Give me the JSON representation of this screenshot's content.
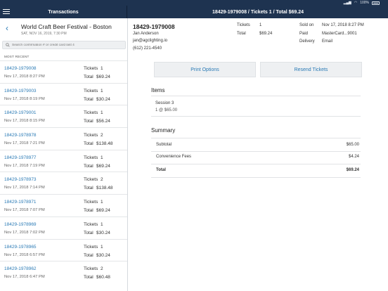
{
  "status": {
    "battery": "100%"
  },
  "nav": {
    "left_title": "Transactions",
    "right_title": "18429-1979008 / Tickets 1 / Total $69.24"
  },
  "event": {
    "name": "World Craft Beer Festival - Boston",
    "date": "SAT, NOV 16, 2019, 7:30 PM"
  },
  "search": {
    "placeholder": "Search confirmation # or credit card last 4"
  },
  "list_label": "MOST RECENT",
  "labels": {
    "tickets": "Tickets",
    "total": "Total"
  },
  "transactions": [
    {
      "id": "18429-1979008",
      "date": "Nov 17, 2018 8:27 PM",
      "tickets": "1",
      "total": "$69.24"
    },
    {
      "id": "18429-1979003",
      "date": "Nov 17, 2018 8:19 PM",
      "tickets": "1",
      "total": "$30.24"
    },
    {
      "id": "18429-1979001",
      "date": "Nov 17, 2018 8:15 PM",
      "tickets": "1",
      "total": "$56.24"
    },
    {
      "id": "18429-1978978",
      "date": "Nov 17, 2018 7:21 PM",
      "tickets": "2",
      "total": "$138.48"
    },
    {
      "id": "18429-1978977",
      "date": "Nov 17, 2018 7:19 PM",
      "tickets": "1",
      "total": "$69.24"
    },
    {
      "id": "18429-1978973",
      "date": "Nov 17, 2018 7:14 PM",
      "tickets": "2",
      "total": "$138.48"
    },
    {
      "id": "18429-1978971",
      "date": "Nov 17, 2018 7:07 PM",
      "tickets": "1",
      "total": "$69.24"
    },
    {
      "id": "18429-1978969",
      "date": "Nov 17, 2018 7:02 PM",
      "tickets": "1",
      "total": "$30.24"
    },
    {
      "id": "18429-1978965",
      "date": "Nov 17, 2018 6:57 PM",
      "tickets": "1",
      "total": "$30.24"
    },
    {
      "id": "18429-1978962",
      "date": "Nov 17, 2018 6:47 PM",
      "tickets": "2",
      "total": "$60.48"
    }
  ],
  "detail": {
    "order_id": "18429-1979008",
    "name": "Jan Anderson",
    "email": "jan@agclighting.io",
    "phone": "(612) 221-4540",
    "tickets_label": "Tickets",
    "tickets_value": "1",
    "total_label": "Total",
    "total_value": "$69.24",
    "sold_on_label": "Sold on",
    "sold_on_value": "Nov 17, 2018 8:27 PM",
    "paid_label": "Paid",
    "paid_value": "MasterCard...9001",
    "delivery_label": "Delivery",
    "delivery_value": "Email"
  },
  "buttons": {
    "print": "Print Options",
    "resend": "Resend Tickets"
  },
  "items": {
    "title": "Items",
    "list": [
      {
        "name": "Session 3",
        "qty": "1 @ $65.00"
      }
    ]
  },
  "summary": {
    "title": "Summary",
    "rows": [
      {
        "label": "Subtotal",
        "value": "$65.00"
      },
      {
        "label": "Convenience Fees",
        "value": "$4.24"
      },
      {
        "label": "Total",
        "value": "$69.24"
      }
    ]
  },
  "colors": {
    "nav_bg": "#1e3350",
    "link": "#2a7ab5"
  }
}
